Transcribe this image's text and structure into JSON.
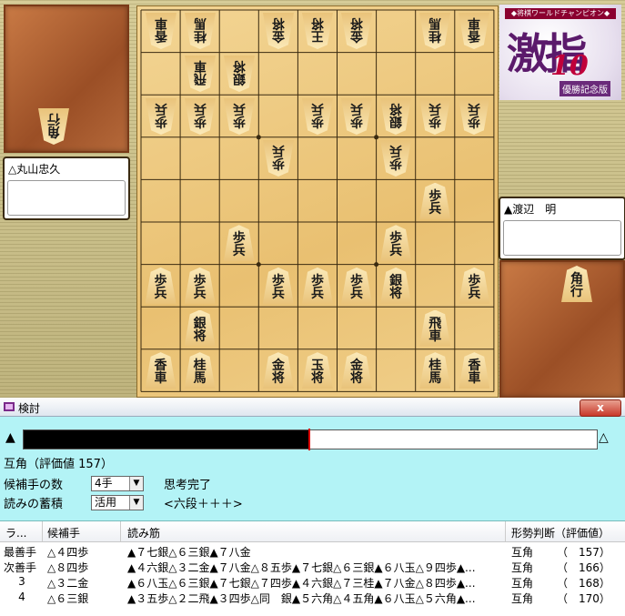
{
  "board": {
    "pieces": [
      {
        "file": 1,
        "rank": 1,
        "c": [
          "香",
          "車"
        ],
        "side": "gote"
      },
      {
        "file": 2,
        "rank": 1,
        "c": [
          "桂",
          "馬"
        ],
        "side": "gote"
      },
      {
        "file": 4,
        "rank": 1,
        "c": [
          "金",
          "将"
        ],
        "side": "gote"
      },
      {
        "file": 5,
        "rank": 1,
        "c": [
          "王",
          "将"
        ],
        "side": "gote"
      },
      {
        "file": 6,
        "rank": 1,
        "c": [
          "金",
          "将"
        ],
        "side": "gote"
      },
      {
        "file": 8,
        "rank": 1,
        "c": [
          "桂",
          "馬"
        ],
        "side": "gote"
      },
      {
        "file": 9,
        "rank": 1,
        "c": [
          "香",
          "車"
        ],
        "side": "gote"
      },
      {
        "file": 7,
        "rank": 2,
        "c": [
          "銀",
          "将"
        ],
        "side": "gote"
      },
      {
        "file": 8,
        "rank": 2,
        "c": [
          "飛",
          "車"
        ],
        "side": "gote"
      },
      {
        "file": 1,
        "rank": 3,
        "c": [
          "歩",
          "兵"
        ],
        "side": "gote"
      },
      {
        "file": 2,
        "rank": 3,
        "c": [
          "歩",
          "兵"
        ],
        "side": "gote"
      },
      {
        "file": 3,
        "rank": 3,
        "c": [
          "銀",
          "将"
        ],
        "side": "gote"
      },
      {
        "file": 4,
        "rank": 3,
        "c": [
          "歩",
          "兵"
        ],
        "side": "gote"
      },
      {
        "file": 5,
        "rank": 3,
        "c": [
          "歩",
          "兵"
        ],
        "side": "gote"
      },
      {
        "file": 7,
        "rank": 3,
        "c": [
          "歩",
          "兵"
        ],
        "side": "gote"
      },
      {
        "file": 8,
        "rank": 3,
        "c": [
          "歩",
          "兵"
        ],
        "side": "gote"
      },
      {
        "file": 9,
        "rank": 3,
        "c": [
          "歩",
          "兵"
        ],
        "side": "gote"
      },
      {
        "file": 3,
        "rank": 4,
        "c": [
          "歩",
          "兵"
        ],
        "side": "gote"
      },
      {
        "file": 6,
        "rank": 4,
        "c": [
          "歩",
          "兵"
        ],
        "side": "gote"
      },
      {
        "file": 2,
        "rank": 5,
        "c": [
          "歩",
          "兵"
        ],
        "side": "sente"
      },
      {
        "file": 3,
        "rank": 6,
        "c": [
          "歩",
          "兵"
        ],
        "side": "sente"
      },
      {
        "file": 7,
        "rank": 6,
        "c": [
          "歩",
          "兵"
        ],
        "side": "sente"
      },
      {
        "file": 1,
        "rank": 7,
        "c": [
          "歩",
          "兵"
        ],
        "side": "sente"
      },
      {
        "file": 3,
        "rank": 7,
        "c": [
          "銀",
          "将"
        ],
        "side": "sente"
      },
      {
        "file": 4,
        "rank": 7,
        "c": [
          "歩",
          "兵"
        ],
        "side": "sente"
      },
      {
        "file": 5,
        "rank": 7,
        "c": [
          "歩",
          "兵"
        ],
        "side": "sente"
      },
      {
        "file": 6,
        "rank": 7,
        "c": [
          "歩",
          "兵"
        ],
        "side": "sente"
      },
      {
        "file": 8,
        "rank": 7,
        "c": [
          "歩",
          "兵"
        ],
        "side": "sente"
      },
      {
        "file": 9,
        "rank": 7,
        "c": [
          "歩",
          "兵"
        ],
        "side": "sente"
      },
      {
        "file": 2,
        "rank": 8,
        "c": [
          "飛",
          "車"
        ],
        "side": "sente"
      },
      {
        "file": 8,
        "rank": 8,
        "c": [
          "銀",
          "将"
        ],
        "side": "sente"
      },
      {
        "file": 1,
        "rank": 9,
        "c": [
          "香",
          "車"
        ],
        "side": "sente"
      },
      {
        "file": 2,
        "rank": 9,
        "c": [
          "桂",
          "馬"
        ],
        "side": "sente"
      },
      {
        "file": 4,
        "rank": 9,
        "c": [
          "金",
          "将"
        ],
        "side": "sente"
      },
      {
        "file": 5,
        "rank": 9,
        "c": [
          "玉",
          "将"
        ],
        "side": "sente"
      },
      {
        "file": 6,
        "rank": 9,
        "c": [
          "金",
          "将"
        ],
        "side": "sente"
      },
      {
        "file": 8,
        "rank": 9,
        "c": [
          "桂",
          "馬"
        ],
        "side": "sente"
      },
      {
        "file": 9,
        "rank": 9,
        "c": [
          "香",
          "車"
        ],
        "side": "sente"
      }
    ]
  },
  "gote_hand": [
    {
      "c": [
        "角",
        "行"
      ]
    }
  ],
  "sente_hand": [
    {
      "c": [
        "角",
        "行"
      ]
    }
  ],
  "players": {
    "gote": "△丸山忠久",
    "sente": "▲渡辺　明"
  },
  "logo": {
    "banner": "◆将棋ワールドチャンピオン◆",
    "main": "激指",
    "ten": "10",
    "sub": "優勝記念版"
  },
  "window": {
    "title": "検討",
    "close": "x"
  },
  "analysis": {
    "sente_mark": "▲",
    "gote_mark": "△",
    "eval_fraction": 0.5,
    "eval_text": "互角（評価値 157）",
    "candidates_label": "候補手の数",
    "candidates_value": "4手",
    "accumulate_label": "読みの蓄積",
    "accumulate_value": "活用",
    "status": "思考完了",
    "level": "<六段＋＋＋>"
  },
  "table": {
    "headers": [
      "ラ...",
      "候補手",
      "読み筋",
      "形勢判断（評価値）"
    ],
    "rows": [
      {
        "rank": "最善手",
        "move": "△４四歩",
        "line": "▲７七銀△６三銀▲７八金",
        "judge": "互角",
        "value": "（　157）"
      },
      {
        "rank": "次善手",
        "move": "△８四歩",
        "line": "▲４六銀△３二金▲７八金△８五歩▲７七銀△６三銀▲６八玉△９四歩▲...",
        "judge": "互角",
        "value": "（　166）"
      },
      {
        "rank": "3",
        "move": "△３二金",
        "line": "▲６八玉△６三銀▲７七銀△７四歩▲４六銀△７三桂▲７八金△８四歩▲...",
        "judge": "互角",
        "value": "（　168）"
      },
      {
        "rank": "4",
        "move": "△６三銀",
        "line": "▲３五歩△２二飛▲３四歩△同　銀▲５六角△４五角▲６八玉△５六角▲...",
        "judge": "互角",
        "value": "（　170）"
      }
    ]
  }
}
